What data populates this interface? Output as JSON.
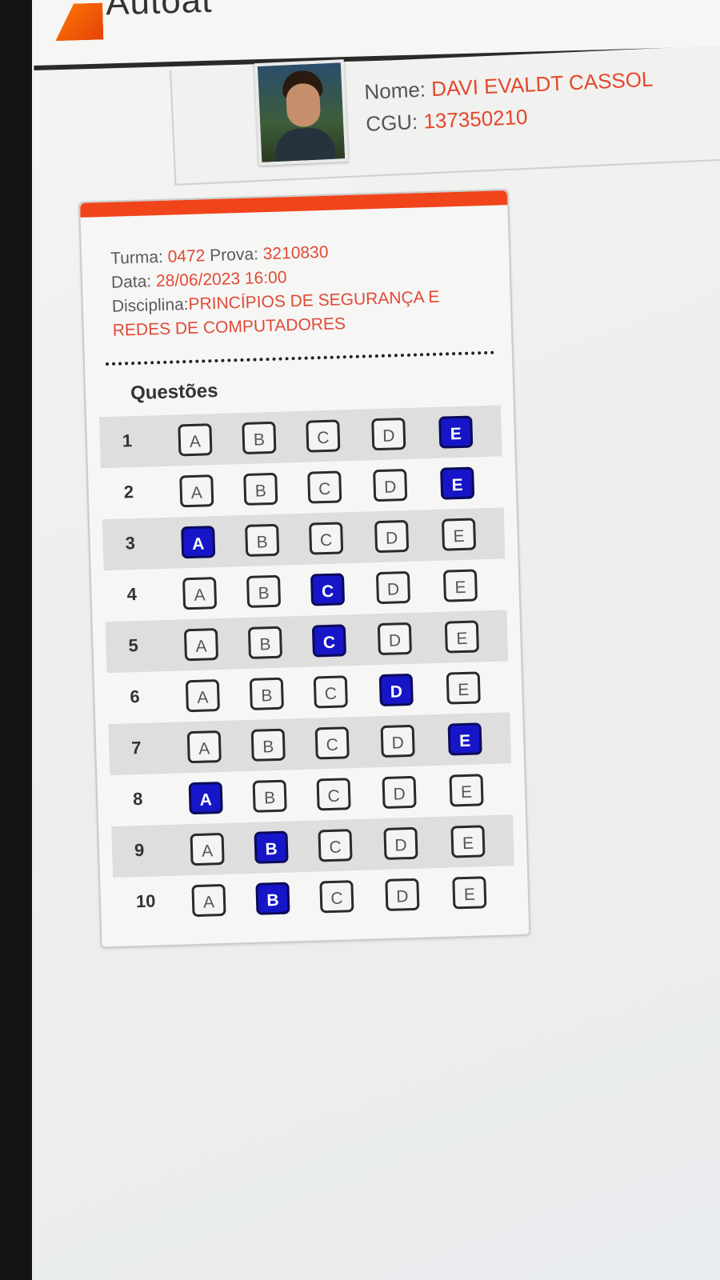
{
  "app": {
    "logo_text": "Autoat"
  },
  "profile": {
    "name_label": "Nome:",
    "name": "DAVI EVALDT CASSOL",
    "cgu_label": "CGU:",
    "cgu": "137350210"
  },
  "exam": {
    "turma_label": "Turma:",
    "turma": "0472",
    "prova_label": "Prova:",
    "prova": "3210830",
    "data_label": "Data:",
    "data": "28/06/2023 16:00",
    "disciplina_label": "Disciplina:",
    "disciplina_line1": "PRINCÍPIOS DE SEGURANÇA E",
    "disciplina_line2": "REDES DE COMPUTADORES"
  },
  "questions_title": "Questões",
  "questions": [
    {
      "num": "1",
      "options": [
        "A",
        "B",
        "C",
        "D",
        "E"
      ],
      "selected": "E"
    },
    {
      "num": "2",
      "options": [
        "A",
        "B",
        "C",
        "D",
        "E"
      ],
      "selected": "E"
    },
    {
      "num": "3",
      "options": [
        "A",
        "B",
        "C",
        "D",
        "E"
      ],
      "selected": "A"
    },
    {
      "num": "4",
      "options": [
        "A",
        "B",
        "C",
        "D",
        "E"
      ],
      "selected": "C"
    },
    {
      "num": "5",
      "options": [
        "A",
        "B",
        "C",
        "D",
        "E"
      ],
      "selected": "C"
    },
    {
      "num": "6",
      "options": [
        "A",
        "B",
        "C",
        "D",
        "E"
      ],
      "selected": "D"
    },
    {
      "num": "7",
      "options": [
        "A",
        "B",
        "C",
        "D",
        "E"
      ],
      "selected": "E"
    },
    {
      "num": "8",
      "options": [
        "A",
        "B",
        "C",
        "D",
        "E"
      ],
      "selected": "A"
    },
    {
      "num": "9",
      "options": [
        "A",
        "B",
        "C",
        "D",
        "E"
      ],
      "selected": "B"
    },
    {
      "num": "10",
      "options": [
        "A",
        "B",
        "C",
        "D",
        "E"
      ],
      "selected": "B"
    }
  ],
  "colors": {
    "accent": "#f0441b",
    "selected": "#1616c8",
    "value_text": "#e5462c"
  }
}
